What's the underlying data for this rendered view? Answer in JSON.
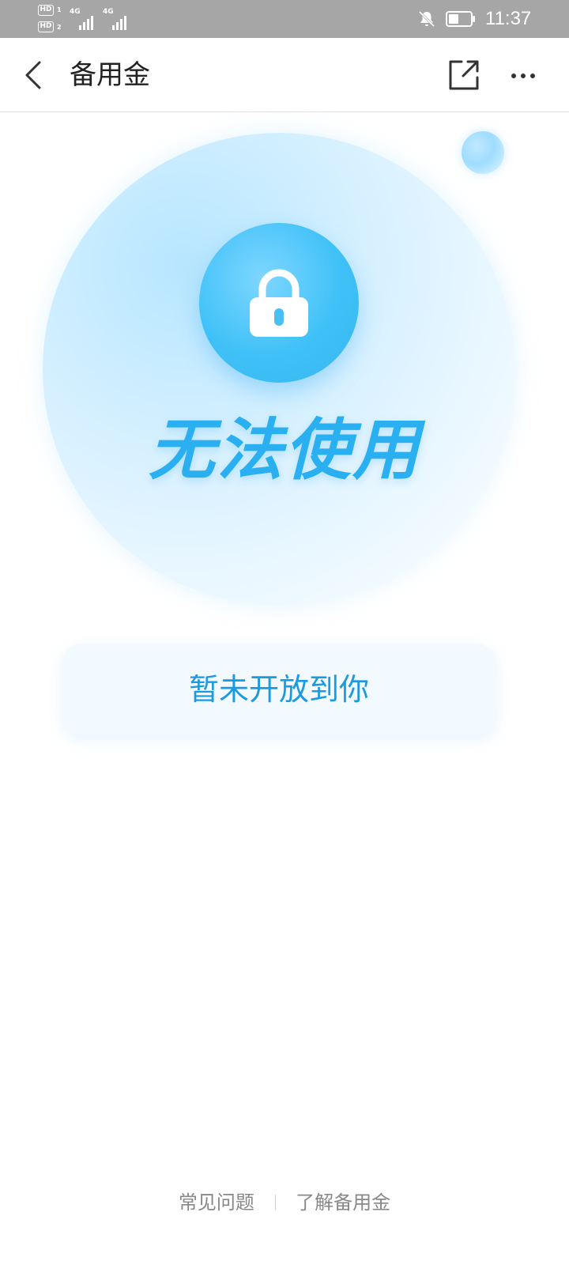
{
  "status_bar": {
    "sim1_badge": "HD",
    "sim1_index": "1",
    "sim2_badge": "HD",
    "sim2_index": "2",
    "network1": "4G",
    "network2": "4G",
    "time": "11:37"
  },
  "header": {
    "title": "备用金"
  },
  "hero": {
    "status_text": "无法使用"
  },
  "notice": {
    "text": "暂未开放到你"
  },
  "footer": {
    "faq_label": "常见问题",
    "learn_label": "了解备用金"
  },
  "colors": {
    "accent": "#2ab0f0",
    "notice_text": "#1b9ae0",
    "status_bar_bg": "#a6a6a6"
  },
  "icons": {
    "back": "chevron-left-icon",
    "share": "share-icon",
    "more": "more-dots-icon",
    "lock": "lock-icon",
    "mute": "bell-muted-icon",
    "battery": "battery-icon"
  }
}
